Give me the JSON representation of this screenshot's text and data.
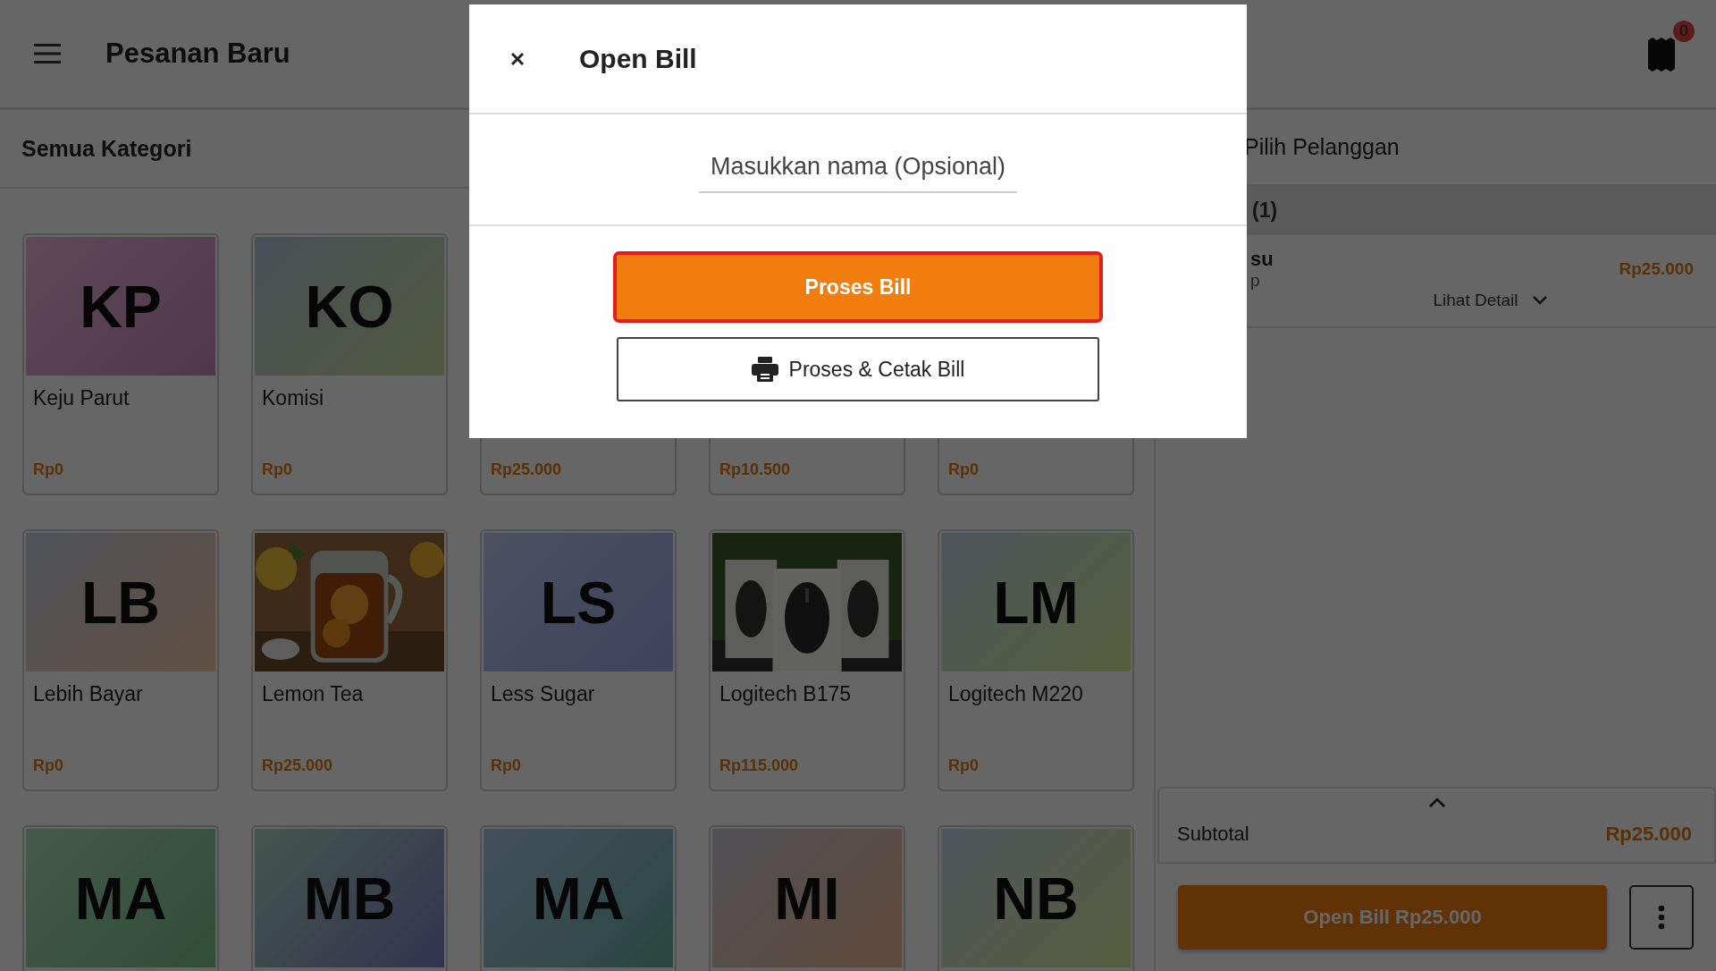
{
  "header": {
    "title": "Pesanan Baru",
    "cart_count": "0"
  },
  "category_bar": {
    "label": "Semua Kategori"
  },
  "products": [
    {
      "kind": "initials",
      "initials": "KP",
      "name": "Keju Parut",
      "price": "Rp0"
    },
    {
      "kind": "initials",
      "initials": "KO",
      "name": "Komisi",
      "price": "Rp0"
    },
    {
      "kind": "covered",
      "price": "Rp25.000"
    },
    {
      "kind": "covered",
      "price": "Rp10.500"
    },
    {
      "kind": "covered",
      "price": "Rp0"
    },
    {
      "kind": "initials",
      "initials": "LB",
      "name": "Lebih Bayar",
      "price": "Rp0"
    },
    {
      "kind": "picture",
      "name": "Lemon Tea",
      "price": "Rp25.000"
    },
    {
      "kind": "initials",
      "initials": "LS",
      "name": "Less Sugar",
      "price": "Rp0"
    },
    {
      "kind": "picture",
      "name": "Logitech B175",
      "price": "Rp115.000"
    },
    {
      "kind": "initials",
      "initials": "LM",
      "name": "Logitech M220",
      "price": "Rp0"
    },
    {
      "kind": "initials",
      "initials": "MA"
    },
    {
      "kind": "initials",
      "initials": "MB"
    },
    {
      "kind": "initials",
      "initials": "MA"
    },
    {
      "kind": "initials",
      "initials": "MI"
    },
    {
      "kind": "initials",
      "initials": "NB"
    }
  ],
  "order_panel": {
    "customer_label": "Pilih Pelanggan",
    "group_label": "(1)",
    "item": {
      "name": "su",
      "note": "p",
      "price": "Rp25.000",
      "detail_link": "Lihat Detail"
    },
    "subtotal_label": "Subtotal",
    "subtotal_value": "Rp25.000",
    "checkout_button": "Open Bill Rp25.000"
  },
  "modal": {
    "title": "Open Bill",
    "name_field": {
      "placeholder": "Masukkan nama (Opsional)"
    },
    "buttons": [
      {
        "kind": "primary",
        "label": "Proses Bill",
        "focused": true
      },
      {
        "kind": "outline",
        "label": "Proses & Cetak Bill",
        "focused": false
      }
    ]
  }
}
